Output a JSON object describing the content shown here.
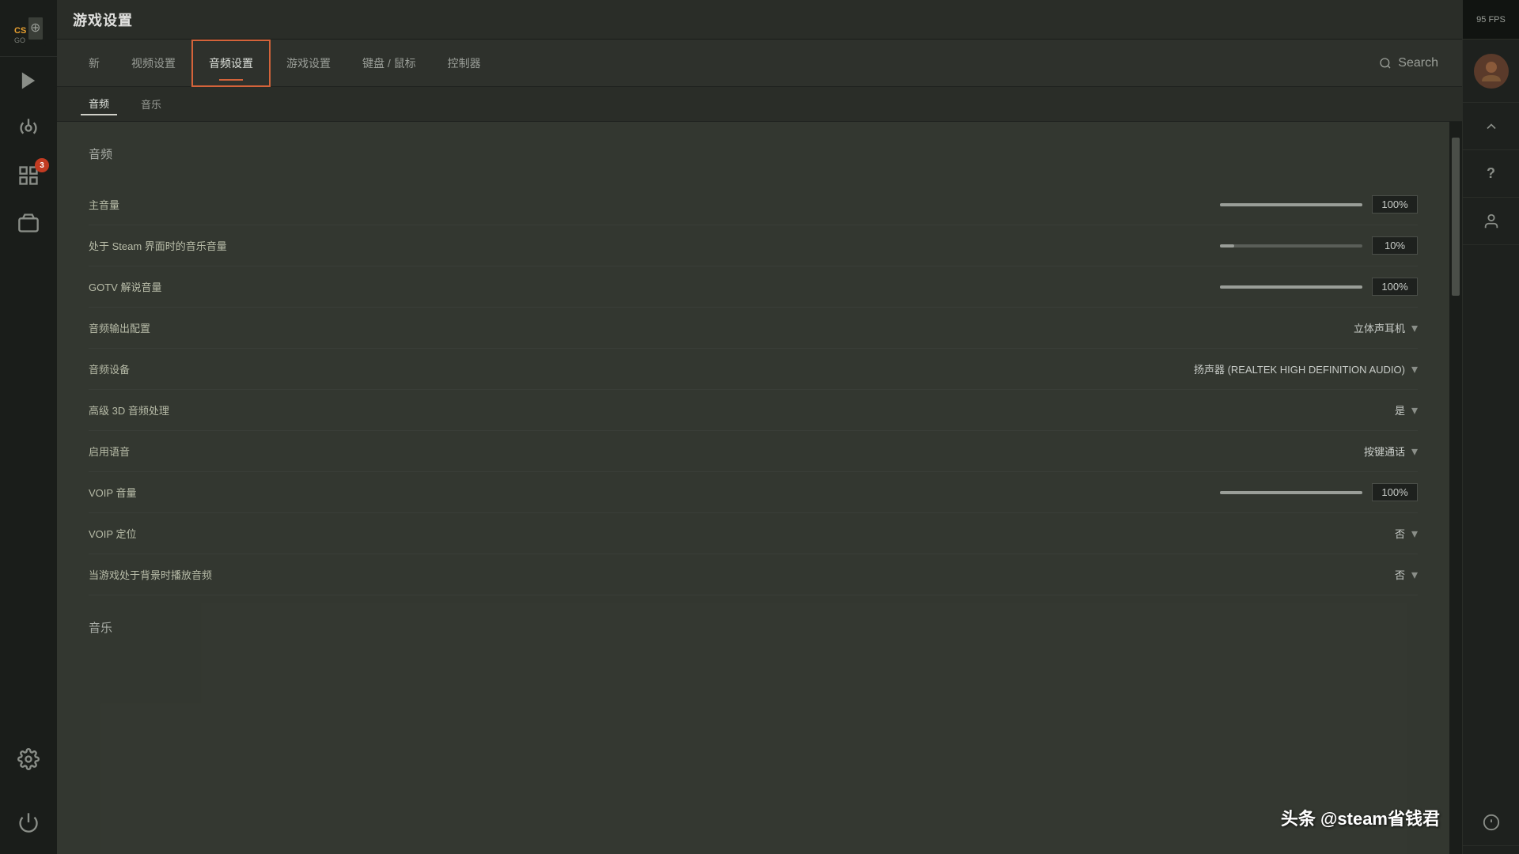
{
  "sidebar": {
    "logo_alt": "CS:GO Logo",
    "fps_label": "95 FPS",
    "nav_items": [
      {
        "id": "play",
        "icon": "play",
        "label": "Play"
      },
      {
        "id": "antenna",
        "icon": "antenna",
        "label": "Antenna"
      },
      {
        "id": "inventory",
        "icon": "inventory",
        "label": "Inventory",
        "badge": "3"
      },
      {
        "id": "tv",
        "icon": "tv",
        "label": "Watch"
      },
      {
        "id": "settings",
        "icon": "settings",
        "label": "Settings"
      }
    ]
  },
  "header": {
    "title": "游戏设置"
  },
  "nav_tabs": [
    {
      "id": "new",
      "label": "新"
    },
    {
      "id": "video",
      "label": "视频设置"
    },
    {
      "id": "audio",
      "label": "音频设置",
      "active": true
    },
    {
      "id": "game",
      "label": "游戏设置"
    },
    {
      "id": "keyboard",
      "label": "键盘 / 鼠标"
    },
    {
      "id": "controller",
      "label": "控制器"
    },
    {
      "id": "search",
      "label": "Search",
      "icon": true
    }
  ],
  "sub_tabs": [
    {
      "id": "audio",
      "label": "音频",
      "active": true
    },
    {
      "id": "music",
      "label": "音乐"
    }
  ],
  "sections": [
    {
      "id": "audio",
      "title": "音频",
      "settings": [
        {
          "id": "master_volume",
          "label": "主音量",
          "type": "slider",
          "value": 100,
          "value_display": "100%",
          "fill_pct": 100
        },
        {
          "id": "steam_music_volume",
          "label": "处于 Steam 界面时的音乐音量",
          "type": "slider",
          "value": 10,
          "value_display": "10%",
          "fill_pct": 10
        },
        {
          "id": "gotv_volume",
          "label": "GOTV 解说音量",
          "type": "slider",
          "value": 100,
          "value_display": "100%",
          "fill_pct": 100
        },
        {
          "id": "audio_output",
          "label": "音频输出配置",
          "type": "dropdown",
          "value": "立体声耳机"
        },
        {
          "id": "audio_device",
          "label": "音频设备",
          "type": "dropdown",
          "value": "扬声器 (REALTEK HIGH DEFINITION AUDIO)"
        },
        {
          "id": "3d_audio",
          "label": "高级 3D 音频处理",
          "type": "dropdown",
          "value": "是"
        },
        {
          "id": "voice_enable",
          "label": "启用语音",
          "type": "dropdown",
          "value": "按键通话"
        },
        {
          "id": "voip_volume",
          "label": "VOIP 音量",
          "type": "slider",
          "value": 100,
          "value_display": "100%",
          "fill_pct": 100
        },
        {
          "id": "voip_positional",
          "label": "VOIP 定位",
          "type": "dropdown",
          "value": "否"
        },
        {
          "id": "bg_audio",
          "label": "当游戏处于背景时播放音频",
          "type": "dropdown",
          "value": "否"
        }
      ]
    },
    {
      "id": "music",
      "title": "音乐",
      "settings": []
    }
  ],
  "watermark": "头条 @steam省钱君"
}
